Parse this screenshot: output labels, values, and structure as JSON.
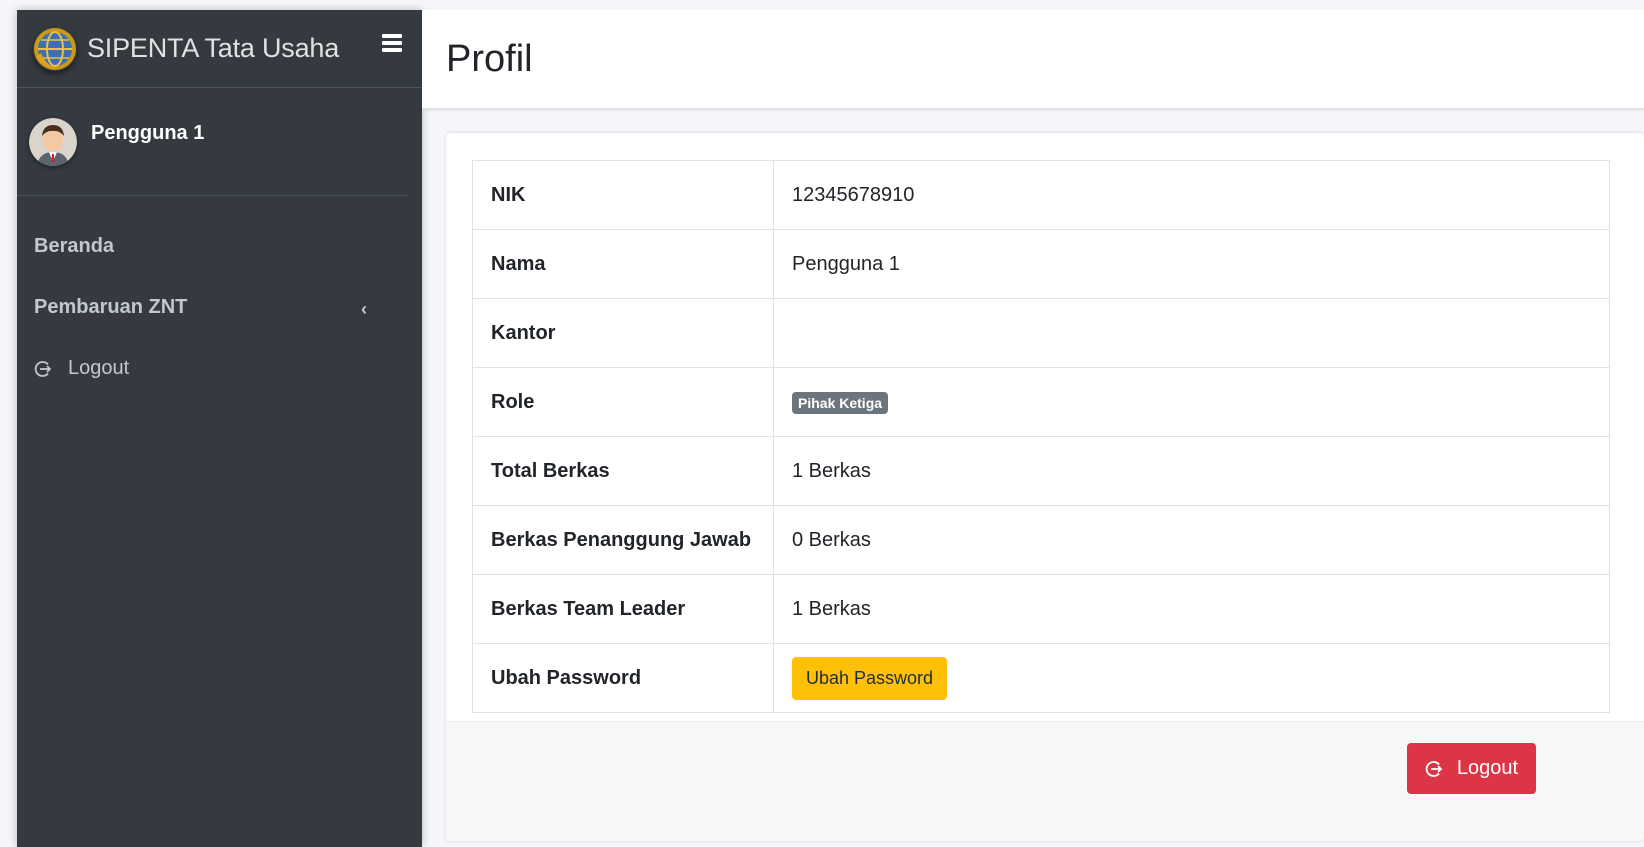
{
  "brand": {
    "title": "SIPENTA Tata Usaha"
  },
  "user": {
    "name": "Pengguna 1"
  },
  "sidebar": {
    "items": [
      {
        "label": "Beranda"
      },
      {
        "label": "Pembaruan ZNT",
        "chevron": "‹"
      },
      {
        "label": "Logout",
        "icon": "logout-icon"
      }
    ]
  },
  "page": {
    "title": "Profil"
  },
  "profile": {
    "rows": [
      {
        "key": "NIK",
        "value": "12345678910"
      },
      {
        "key": "Nama",
        "value": "Pengguna 1"
      },
      {
        "key": "Kantor",
        "value": ""
      },
      {
        "key": "Role",
        "badge": "Pihak Ketiga"
      },
      {
        "key": "Total Berkas",
        "value": "1 Berkas"
      },
      {
        "key": "Berkas Penanggung Jawab",
        "value": "0 Berkas"
      },
      {
        "key": "Berkas Team Leader",
        "value": "1 Berkas"
      },
      {
        "key": "Ubah Password",
        "button": "Ubah Password"
      }
    ]
  },
  "footer": {
    "logout_label": "Logout"
  },
  "colors": {
    "sidebar_bg": "#343a40",
    "badge_bg": "#6c757d",
    "warning": "#ffc107",
    "danger": "#dc3545"
  }
}
